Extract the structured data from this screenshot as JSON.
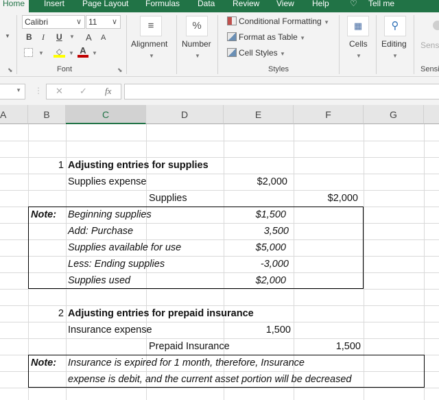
{
  "ribbon_tabs": [
    "Home",
    "Insert",
    "Page Layout",
    "Formulas",
    "Data",
    "Review",
    "View",
    "Help",
    "Tell me"
  ],
  "active_tab": "Home",
  "font_group": {
    "label": "Font",
    "font_name": "Calibri",
    "font_size": "11",
    "bold": "B",
    "italic": "I",
    "underline": "U",
    "grow_font": "A",
    "shrink_font": "A",
    "font_color_hex": "#c00000",
    "highlight_color_hex": "#ffff00"
  },
  "alignment": {
    "label": "Alignment",
    "icon": "≡"
  },
  "number": {
    "label": "Number",
    "icon": "%"
  },
  "styles": {
    "label": "Styles",
    "items": [
      "Conditional Formatting",
      "Format as Table",
      "Cell Styles"
    ]
  },
  "cells": {
    "label": "Cells"
  },
  "editing": {
    "label": "Editing"
  },
  "sensitivity": {
    "label": "Sensi",
    "group_label": "Sensi"
  },
  "formula_bar": {
    "cancel": "✕",
    "enter": "✓",
    "fx": "fx",
    "value": ""
  },
  "columns": [
    "A",
    "B",
    "C",
    "D",
    "E",
    "F",
    "G"
  ],
  "selected_column": "C",
  "sheet": {
    "section1": {
      "number": "1",
      "title": "Adjusting entries for supplies",
      "debit_account": "Supplies expense",
      "debit_amount": "$2,000",
      "credit_account": "Supplies",
      "credit_amount": "$2,000",
      "note_label": "Note:",
      "note_rows": [
        {
          "label": "Beginning supplies",
          "amount": "$1,500"
        },
        {
          "label": "Add: Purchase",
          "amount": "3,500"
        },
        {
          "label": "Supplies available for use",
          "amount": "$5,000"
        },
        {
          "label": "Less: Ending supplies",
          "amount": "-3,000"
        },
        {
          "label": "Supplies used",
          "amount": "$2,000"
        }
      ]
    },
    "section2": {
      "number": "2",
      "title": "Adjusting entries for prepaid insurance",
      "debit_account": "Insurance expense",
      "debit_amount": "1,500",
      "credit_account": "Prepaid Insurance",
      "credit_amount": "1,500",
      "note_label": "Note:",
      "note_lines": [
        "Insurance is expired for 1 month, therefore, Insurance",
        "expense is debit, and the current asset portion will be decreased"
      ]
    }
  }
}
